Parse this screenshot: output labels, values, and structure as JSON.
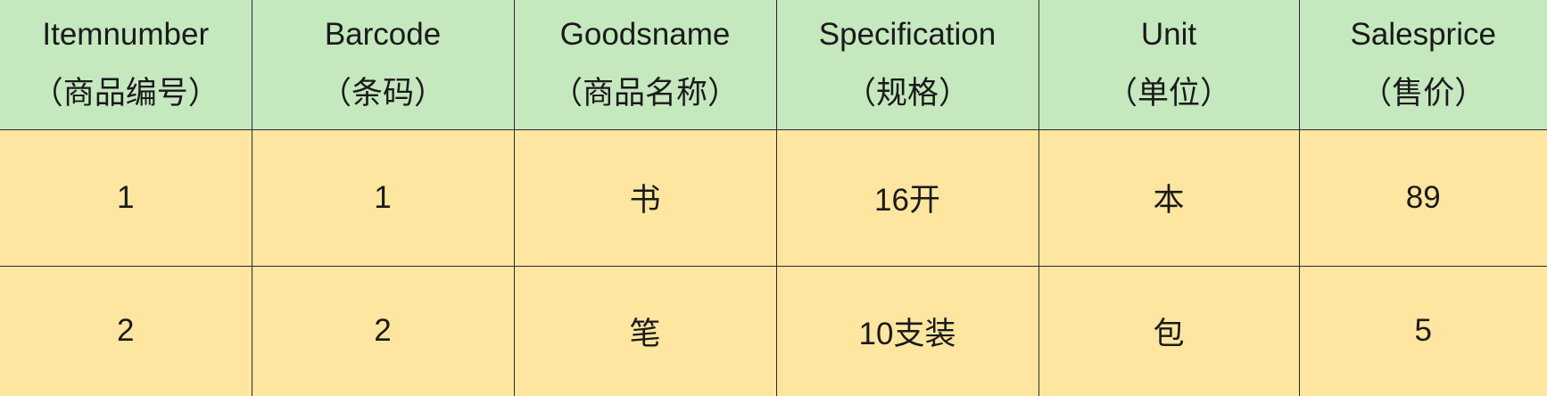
{
  "table": {
    "columns": [
      {
        "en": "Itemnumber",
        "zh": "（商品编号）"
      },
      {
        "en": "Barcode",
        "zh": "（条码）"
      },
      {
        "en": "Goodsname",
        "zh": "（商品名称）"
      },
      {
        "en": "Specification",
        "zh": "（规格）"
      },
      {
        "en": "Unit",
        "zh": "（单位）"
      },
      {
        "en": "Salesprice",
        "zh": "（售价）"
      }
    ],
    "rows": [
      [
        "1",
        "1",
        "书",
        "16开",
        "本",
        "89"
      ],
      [
        "2",
        "2",
        "笔",
        "10支装",
        "包",
        "5"
      ]
    ]
  },
  "colors": {
    "header_bg": "#c5e8bf",
    "body_bg": "#ffe6a0",
    "border": "#2b2b2b"
  }
}
